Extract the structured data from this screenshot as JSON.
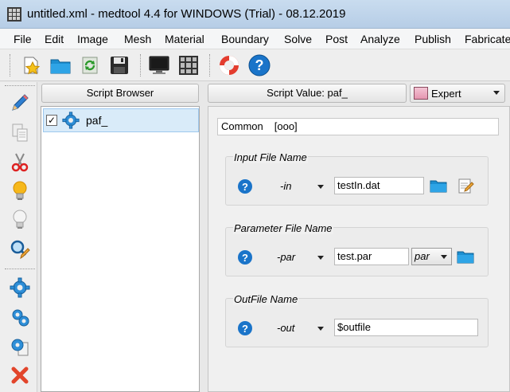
{
  "window": {
    "title": "untitled.xml - medtool 4.4 for WINDOWS (Trial) - 08.12.2019",
    "app_icon": "grid-app-icon"
  },
  "menu": [
    "File",
    "Edit",
    "Image",
    "Mesh",
    "Material",
    "Boundary",
    "Solve",
    "Post",
    "Analyze",
    "Publish",
    "Fabricate"
  ],
  "toolbar": {
    "icons": [
      "new-file-icon",
      "open-folder-icon",
      "refresh-icon",
      "save-icon",
      "monitor-icon",
      "grid-view-icon",
      "lifebuoy-help-icon",
      "help-icon"
    ]
  },
  "left_tools": {
    "icons": [
      "pencil-icon",
      "copy-icon",
      "scissors-icon",
      "lightbulb-on-icon",
      "lightbulb-off-icon",
      "search-edit-icon",
      "gear-icon",
      "gears-icon",
      "gear-document-icon",
      "delete-icon"
    ]
  },
  "script_browser": {
    "header": "Script Browser",
    "items": [
      {
        "label": "paf_",
        "checked": true,
        "icon": "gear-icon"
      }
    ]
  },
  "script_value": {
    "header": "Script Value: paf_",
    "mode": {
      "label": "Expert",
      "color": "#e595b0"
    },
    "common": {
      "label": "Common",
      "value": "[ooo]"
    },
    "groups": [
      {
        "title": "Input File Name",
        "flag": "-in",
        "value": "testIn.dat"
      },
      {
        "title": "Parameter File Name",
        "flag": "-par",
        "value": "test.par",
        "type": "par"
      },
      {
        "title": "OutFile Name",
        "flag": "-out",
        "value": "$outfile"
      }
    ]
  }
}
